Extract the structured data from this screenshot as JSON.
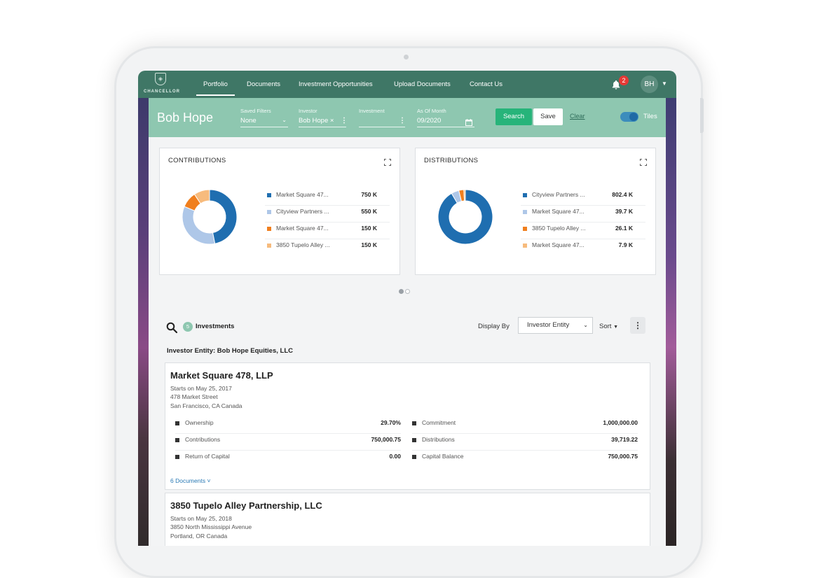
{
  "nav": {
    "logo_text": "CHANCELLOR",
    "items": [
      {
        "label": "Portfolio",
        "active": true
      },
      {
        "label": "Documents"
      },
      {
        "label": "Investment Opportunities"
      },
      {
        "label": "Upload Documents"
      },
      {
        "label": "Contact Us"
      }
    ],
    "notification_count": "2",
    "avatar_initials": "BH"
  },
  "filters": {
    "investor_name": "Bob Hope",
    "saved_filters": {
      "label": "Saved Filters",
      "value": "None"
    },
    "investor": {
      "label": "Investor",
      "value": "Bob Hope ×"
    },
    "investment": {
      "label": "Investment",
      "value": ""
    },
    "as_of_month": {
      "label": "As Of Month",
      "value": "09/2020"
    },
    "search_label": "Search",
    "save_label": "Save",
    "clear_label": "Clear",
    "tiles_label": "Tiles",
    "tiles_on": true
  },
  "cards": [
    {
      "title": "CONTRIBUTIONS",
      "items": [
        {
          "name": "Market Square 47...",
          "value": "750 K",
          "amount": 750,
          "color": "#1f6eb0"
        },
        {
          "name": "Cityview Partners ...",
          "value": "550 K",
          "amount": 550,
          "color": "#aec7e8"
        },
        {
          "name": "Market Square 47...",
          "value": "150 K",
          "amount": 150,
          "color": "#f07f1e"
        },
        {
          "name": "3850 Tupelo Alley ...",
          "value": "150 K",
          "amount": 150,
          "color": "#f7bb7d"
        }
      ]
    },
    {
      "title": "DISTRIBUTIONS",
      "items": [
        {
          "name": "Cityview Partners ...",
          "value": "802.4 K",
          "amount": 802.4,
          "color": "#1f6eb0"
        },
        {
          "name": "Market Square 47...",
          "value": "39.7 K",
          "amount": 39.7,
          "color": "#aec7e8"
        },
        {
          "name": "3850 Tupelo Alley ...",
          "value": "26.1 K",
          "amount": 26.1,
          "color": "#f07f1e"
        },
        {
          "name": "Market Square 47...",
          "value": "7.9 K",
          "amount": 7.9,
          "color": "#f7bb7d"
        }
      ]
    }
  ],
  "investments": {
    "count": "5",
    "label": "Investments",
    "display_by_label": "Display By",
    "display_by_value": "Investor Entity",
    "sort_label": "Sort",
    "entity_label": "Investor Entity: Bob Hope Equities, LLC",
    "list": [
      {
        "name": "Market Square 478, LLP",
        "start": "Starts on May 25, 2017",
        "address1": "478 Market Street",
        "address2": "San Francisco, CA Canada",
        "metrics_left": [
          {
            "label": "Ownership",
            "value": "29.70%"
          },
          {
            "label": "Contributions",
            "value": "750,000.75"
          },
          {
            "label": "Return of Capital",
            "value": "0.00"
          }
        ],
        "metrics_right": [
          {
            "label": "Commitment",
            "value": "1,000,000.00"
          },
          {
            "label": "Distributions",
            "value": "39,719.22"
          },
          {
            "label": "Capital Balance",
            "value": "750,000.75"
          }
        ],
        "docs_label": "6 Documents ˅"
      },
      {
        "name": "3850 Tupelo Alley Partnership, LLC",
        "start": "Starts on May 25, 2018",
        "address1": "3850 North Mississippi Avenue",
        "address2": "Portland, OR Canada"
      }
    ]
  },
  "colors": {
    "nav": "#3f7766",
    "filterbar": "#8ec7b0",
    "search": "#27b47a"
  }
}
